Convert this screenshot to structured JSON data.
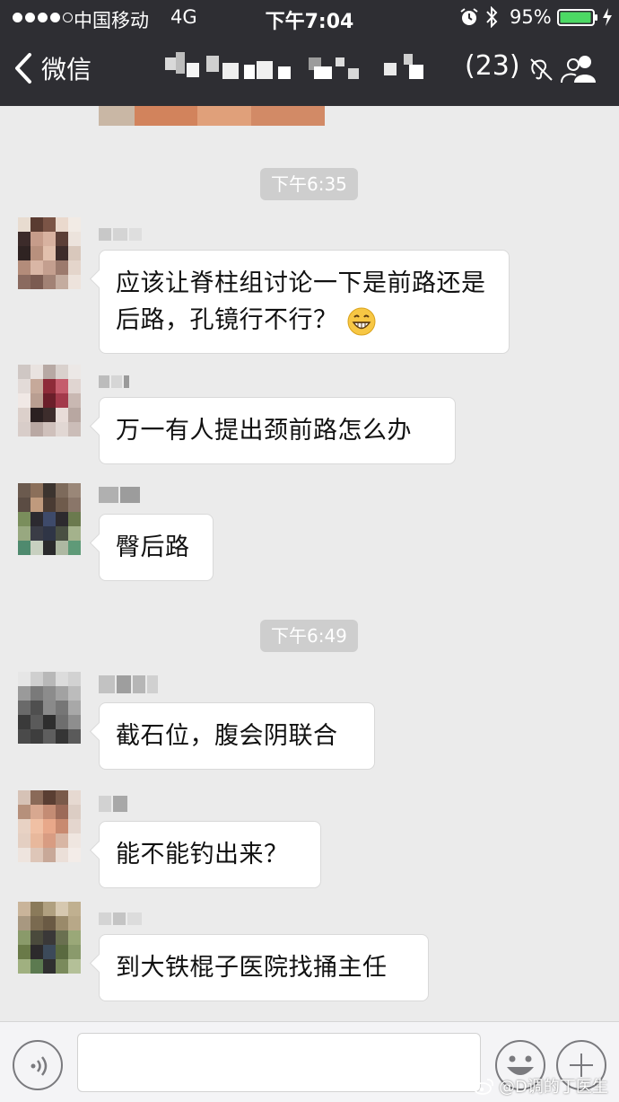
{
  "status_bar": {
    "carrier": "中国移动",
    "network": "4G",
    "time": "下午7:04",
    "battery": "95%"
  },
  "nav": {
    "back_label": "微信",
    "member_count": "(23)"
  },
  "messages": [
    {
      "type": "time",
      "text": "下午6:35"
    },
    {
      "type": "message",
      "text": "应该让脊柱组讨论一下是前路还是后路，孔镜行不行？",
      "emoji": "grinning-face"
    },
    {
      "type": "message",
      "text": "万一有人提出颈前路怎么办"
    },
    {
      "type": "message",
      "text": "臀后路"
    },
    {
      "type": "time",
      "text": "下午6:49"
    },
    {
      "type": "message",
      "text": "截石位，腹会阴联合"
    },
    {
      "type": "message",
      "text": "能不能钓出来？"
    },
    {
      "type": "message",
      "text": "到大铁棍子医院找捅主任"
    }
  ],
  "input_bar": {
    "text": ""
  },
  "watermark": "@D调的丁医生",
  "colors": {
    "header_bg": "#2e2e33",
    "chat_bg": "#ebebeb",
    "bubble_bg": "#ffffff",
    "time_pill_bg": "#cecece"
  }
}
